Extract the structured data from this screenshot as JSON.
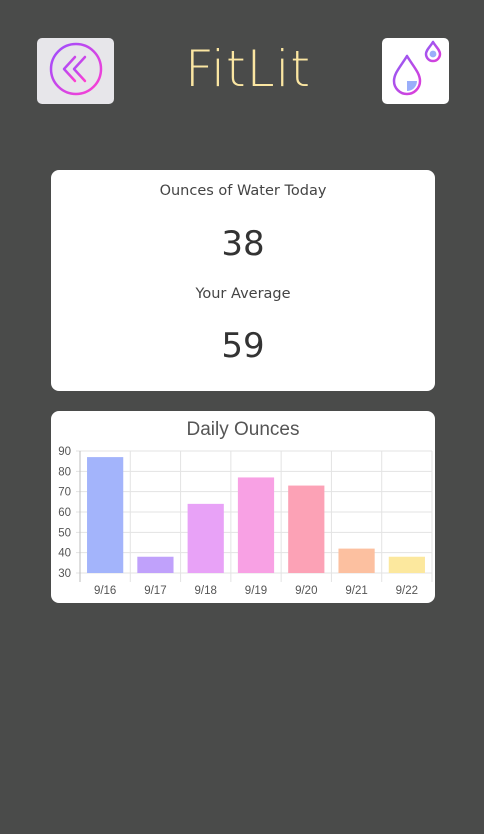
{
  "header": {
    "title": "FitLit",
    "title_color": "#fbe6a2",
    "back_icon": "chevron-left-circle-icon",
    "water_icon": "water-drops-icon"
  },
  "stats": {
    "today_label": "Ounces of Water Today",
    "today_value": "38",
    "average_label": "Your Average",
    "average_value": "59"
  },
  "chart_data": {
    "type": "bar",
    "title": "Daily Ounces",
    "categories": [
      "9/16",
      "9/17",
      "9/18",
      "9/19",
      "9/20",
      "9/21",
      "9/22"
    ],
    "values": [
      87,
      38,
      64,
      77,
      73,
      42,
      38
    ],
    "colors": [
      "#a3b4fb",
      "#c0a1fb",
      "#e8a2f7",
      "#f8a1e4",
      "#fca2b6",
      "#fcc0a0",
      "#fce89e"
    ],
    "ylim": [
      30,
      90
    ],
    "yticks": [
      90,
      80,
      70,
      60,
      50,
      40,
      30
    ],
    "grid": true,
    "legend": "none"
  }
}
